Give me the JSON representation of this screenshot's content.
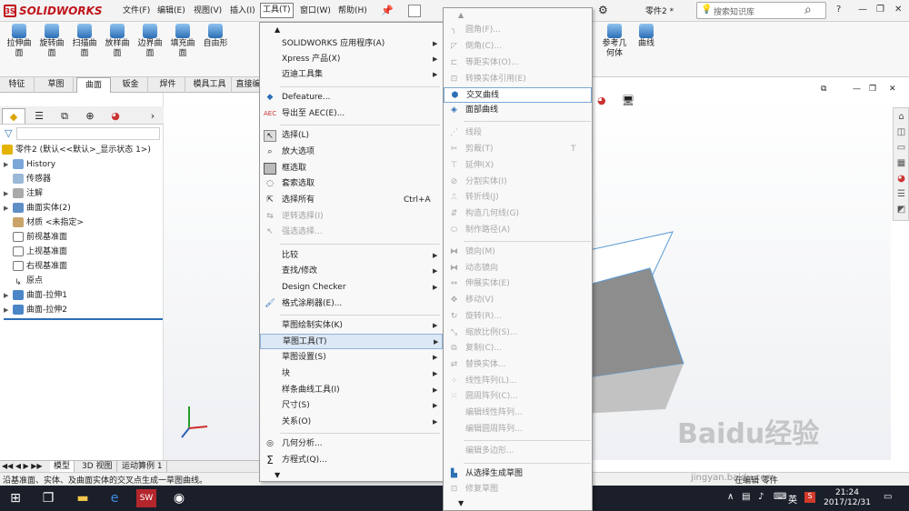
{
  "app": {
    "logo": "SOLIDWORKS",
    "part_name": "零件2 *",
    "search_placeholder": "搜索知识库"
  },
  "menubar": [
    "文件(F)",
    "编辑(E)",
    "视图(V)",
    "插入(I)",
    "工具(T)",
    "窗口(W)",
    "帮助(H)"
  ],
  "ribbon": [
    "拉伸曲面",
    "旋转曲面",
    "扫描曲面",
    "放样曲面",
    "边界曲面",
    "填充曲面",
    "自由形"
  ],
  "ribbon_right": [
    "参考几何体",
    "曲线"
  ],
  "cmd_tabs": [
    "特征",
    "草图",
    "曲面",
    "钣金",
    "焊件",
    "模具工具",
    "直接编"
  ],
  "tree": {
    "root": "零件2 (默认<<默认>_显示状态 1>)",
    "items": [
      "History",
      "传感器",
      "注解",
      "曲面实体(2)",
      "材质 <未指定>",
      "前视基准面",
      "上视基准面",
      "右视基准面",
      "原点",
      "曲面-拉伸1",
      "曲面-拉伸2"
    ]
  },
  "bottom_tabs": [
    "模型",
    "3D 视图",
    "运动算例 1"
  ],
  "status": "沿基准面、实体、及曲面实体的交叉点生成一草图曲线。",
  "status_right": "在编辑 零件",
  "tools_menu": {
    "items": [
      {
        "label": "SOLIDWORKS 应用程序(A)",
        "sub": true
      },
      {
        "label": "Xpress 产品(X)",
        "sub": true
      },
      {
        "label": "迈迪工具集",
        "sub": true
      },
      {
        "label": "Defeature..."
      },
      {
        "label": "导出至 AEC(E)..."
      },
      {
        "label": "选择(L)"
      },
      {
        "label": "放大选项"
      },
      {
        "label": "框选取"
      },
      {
        "label": "套索选取"
      },
      {
        "label": "选择所有",
        "shortcut": "Ctrl+A"
      },
      {
        "label": "逆转选择(I)",
        "disabled": true
      },
      {
        "label": "强选选择...",
        "disabled": true
      },
      {
        "label": "比较",
        "sub": true
      },
      {
        "label": "查找/修改",
        "sub": true
      },
      {
        "label": "Design Checker",
        "sub": true
      },
      {
        "label": "格式涂刷器(E)..."
      },
      {
        "label": "草图绘制实体(K)",
        "sub": true
      },
      {
        "label": "草图工具(T)",
        "sub": true
      },
      {
        "label": "草图设置(S)",
        "sub": true
      },
      {
        "label": "块",
        "sub": true
      },
      {
        "label": "样条曲线工具(I)",
        "sub": true
      },
      {
        "label": "尺寸(S)",
        "sub": true
      },
      {
        "label": "关系(O)",
        "sub": true
      },
      {
        "label": "几何分析..."
      },
      {
        "label": "方程式(Q)..."
      }
    ]
  },
  "sub_menu": {
    "items": [
      {
        "label": "圆角(F)...",
        "disabled": true
      },
      {
        "label": "倒角(C)...",
        "disabled": true
      },
      {
        "label": "等距实体(O)...",
        "disabled": true
      },
      {
        "label": "转换实体引用(E)",
        "disabled": true
      },
      {
        "label": "交叉曲线"
      },
      {
        "label": "面部曲线"
      },
      {
        "label": "线段",
        "disabled": true
      },
      {
        "label": "剪裁(T)",
        "shortcut": "T",
        "disabled": true
      },
      {
        "label": "延伸(X)",
        "disabled": true
      },
      {
        "label": "分割实体(I)",
        "disabled": true
      },
      {
        "label": "转折线(J)",
        "disabled": true
      },
      {
        "label": "构造几何线(G)",
        "disabled": true
      },
      {
        "label": "制作路径(A)",
        "disabled": true
      },
      {
        "label": "镜向(M)",
        "disabled": true
      },
      {
        "label": "动态镜向",
        "disabled": true
      },
      {
        "label": "伸展实体(E)",
        "disabled": true
      },
      {
        "label": "移动(V)",
        "disabled": true
      },
      {
        "label": "旋转(R)...",
        "disabled": true
      },
      {
        "label": "缩放比例(S)...",
        "disabled": true
      },
      {
        "label": "复制(C)...",
        "disabled": true
      },
      {
        "label": "替换实体...",
        "disabled": true
      },
      {
        "label": "线性阵列(L)...",
        "disabled": true
      },
      {
        "label": "圆周阵列(C)...",
        "disabled": true
      },
      {
        "label": "编辑线性阵列...",
        "disabled": true
      },
      {
        "label": "编辑圆周阵列...",
        "disabled": true
      },
      {
        "label": "编辑多边形...",
        "disabled": true
      },
      {
        "label": "从选择生成草图"
      },
      {
        "label": "修复草图",
        "disabled": true
      }
    ]
  },
  "taskbar": {
    "time": "21:24",
    "date": "2017/12/31",
    "ime": "英"
  },
  "watermark": "Baidu经验",
  "watermark_url": "jingyan.baidu.com"
}
